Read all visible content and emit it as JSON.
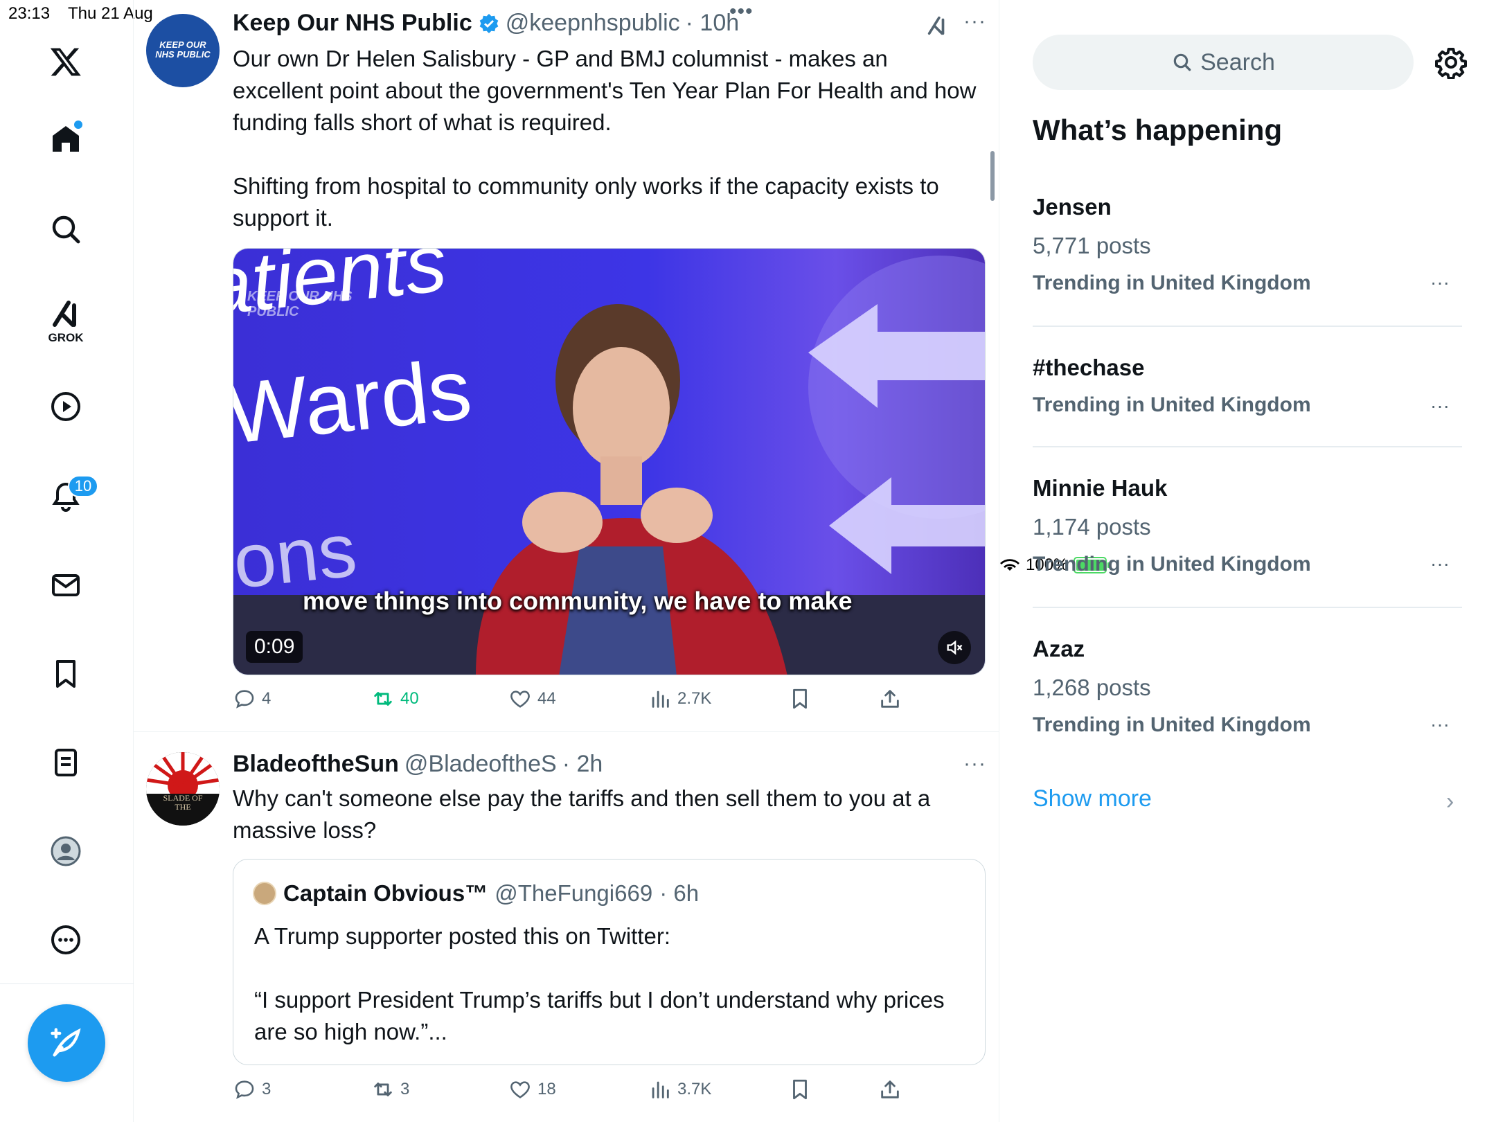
{
  "status_bar": {
    "time": "23:13",
    "date": "Thu 21 Aug",
    "battery": "100%"
  },
  "nav": {
    "grok_label": "GROK",
    "notifications_count": "10",
    "items": [
      "home-icon",
      "search-icon",
      "grok-icon",
      "video-icon",
      "bell-icon",
      "mail-icon",
      "bookmark-icon",
      "lists-icon",
      "profile-icon",
      "more-icon"
    ]
  },
  "tweet1": {
    "avatar_text": "KEEP OUR NHS PUBLIC",
    "name": "Keep Our NHS Public",
    "handle": "@keepnhspublic",
    "time": "· 10h",
    "text_p1": "Our own Dr Helen Salisbury - GP and BMJ columnist - makes an excellent point about the government's Ten Year Plan For Health and how funding falls short of what is required.",
    "text_p2": "Shifting from hospital to community only works if the capacity exists to support it.",
    "video": {
      "screen_text_1": "atients",
      "screen_text_2": "Wards",
      "screen_text_3": "ons",
      "watermark": "KEEP OUR NHS PUBLIC",
      "caption": "move things into community, we have to make",
      "duration": "0:09"
    },
    "replies": "4",
    "reposts": "40",
    "likes": "44",
    "views": "2.7K"
  },
  "tweet2": {
    "avatar_text": "SLADE OF THE",
    "name": "BladeoftheSun",
    "handle": "@BladeoftheS",
    "time": "· 2h",
    "text": "Why can't someone else pay the tariffs and then sell them to you at a massive loss?",
    "quote": {
      "name": "Captain Obvious™",
      "handle": "@TheFungi669",
      "time": "· 6h",
      "text_p1": "A Trump supporter posted this on Twitter:",
      "text_p2": "“I support President Trump’s tariffs but I don’t understand why prices are so high now.”..."
    },
    "replies": "3",
    "reposts": "3",
    "likes": "18",
    "views": "3.7K"
  },
  "sidebar": {
    "search_placeholder": "Search",
    "title": "What’s happening",
    "trends": [
      {
        "name": "Jensen",
        "posts": "5,771 posts",
        "context": "Trending in United Kingdom"
      },
      {
        "name": "#thechase",
        "posts": "",
        "context": "Trending in United Kingdom"
      },
      {
        "name": "Minnie Hauk",
        "posts": "1,174 posts",
        "context": "Trending in United Kingdom"
      },
      {
        "name": "Azaz",
        "posts": "1,268 posts",
        "context": "Trending in United Kingdom"
      }
    ],
    "show_more": "Show more"
  },
  "colors": {
    "accent": "#1d9bf0",
    "repost": "#00ba7c",
    "text": "#0f1419",
    "muted": "#536471"
  }
}
